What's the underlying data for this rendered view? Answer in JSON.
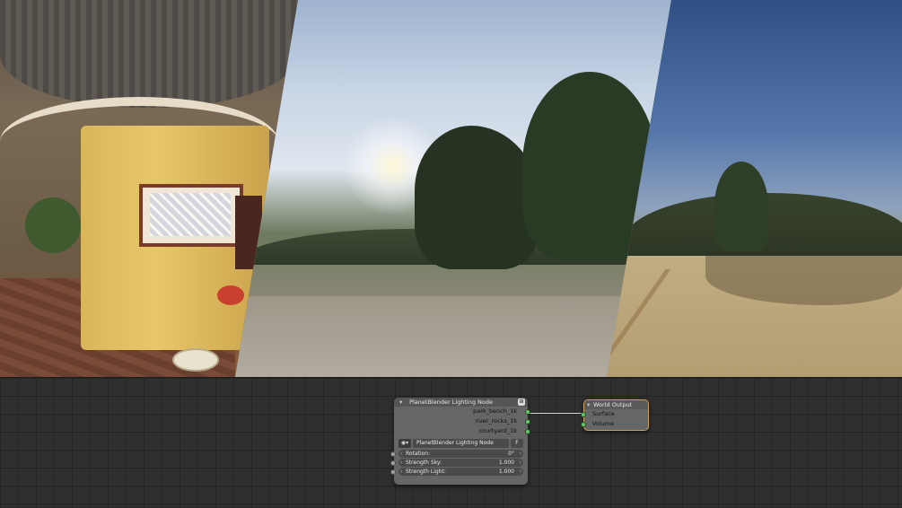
{
  "preview": {
    "panels": [
      "park_bench_1k",
      "river_rocks_1k",
      "courtyard_1k"
    ]
  },
  "lighting_node": {
    "title": "PlanetBlender Lighting Node",
    "header_icon": "node-options-icon",
    "outputs": [
      "park_bench_1k",
      "river_rocks_1k",
      "courtyard_1k"
    ],
    "selector": {
      "icon": "node-tree-icon",
      "value": "PlanetBlender Lighting Node",
      "fake_user_label": "F"
    },
    "inputs": [
      {
        "label": "Rotation:",
        "value": "0°"
      },
      {
        "label": "Strength Sky:",
        "value": "1.000"
      },
      {
        "label": "Strength Light:",
        "value": "1.000"
      }
    ]
  },
  "world_output": {
    "title": "World Output",
    "inputs": [
      "Surface",
      "Volume"
    ]
  },
  "colors": {
    "socket_shader": "#63c763",
    "socket_value": "#a1a1a1",
    "editor_bg": "#2f2f2f",
    "active_node_border": "#c9a25a"
  }
}
